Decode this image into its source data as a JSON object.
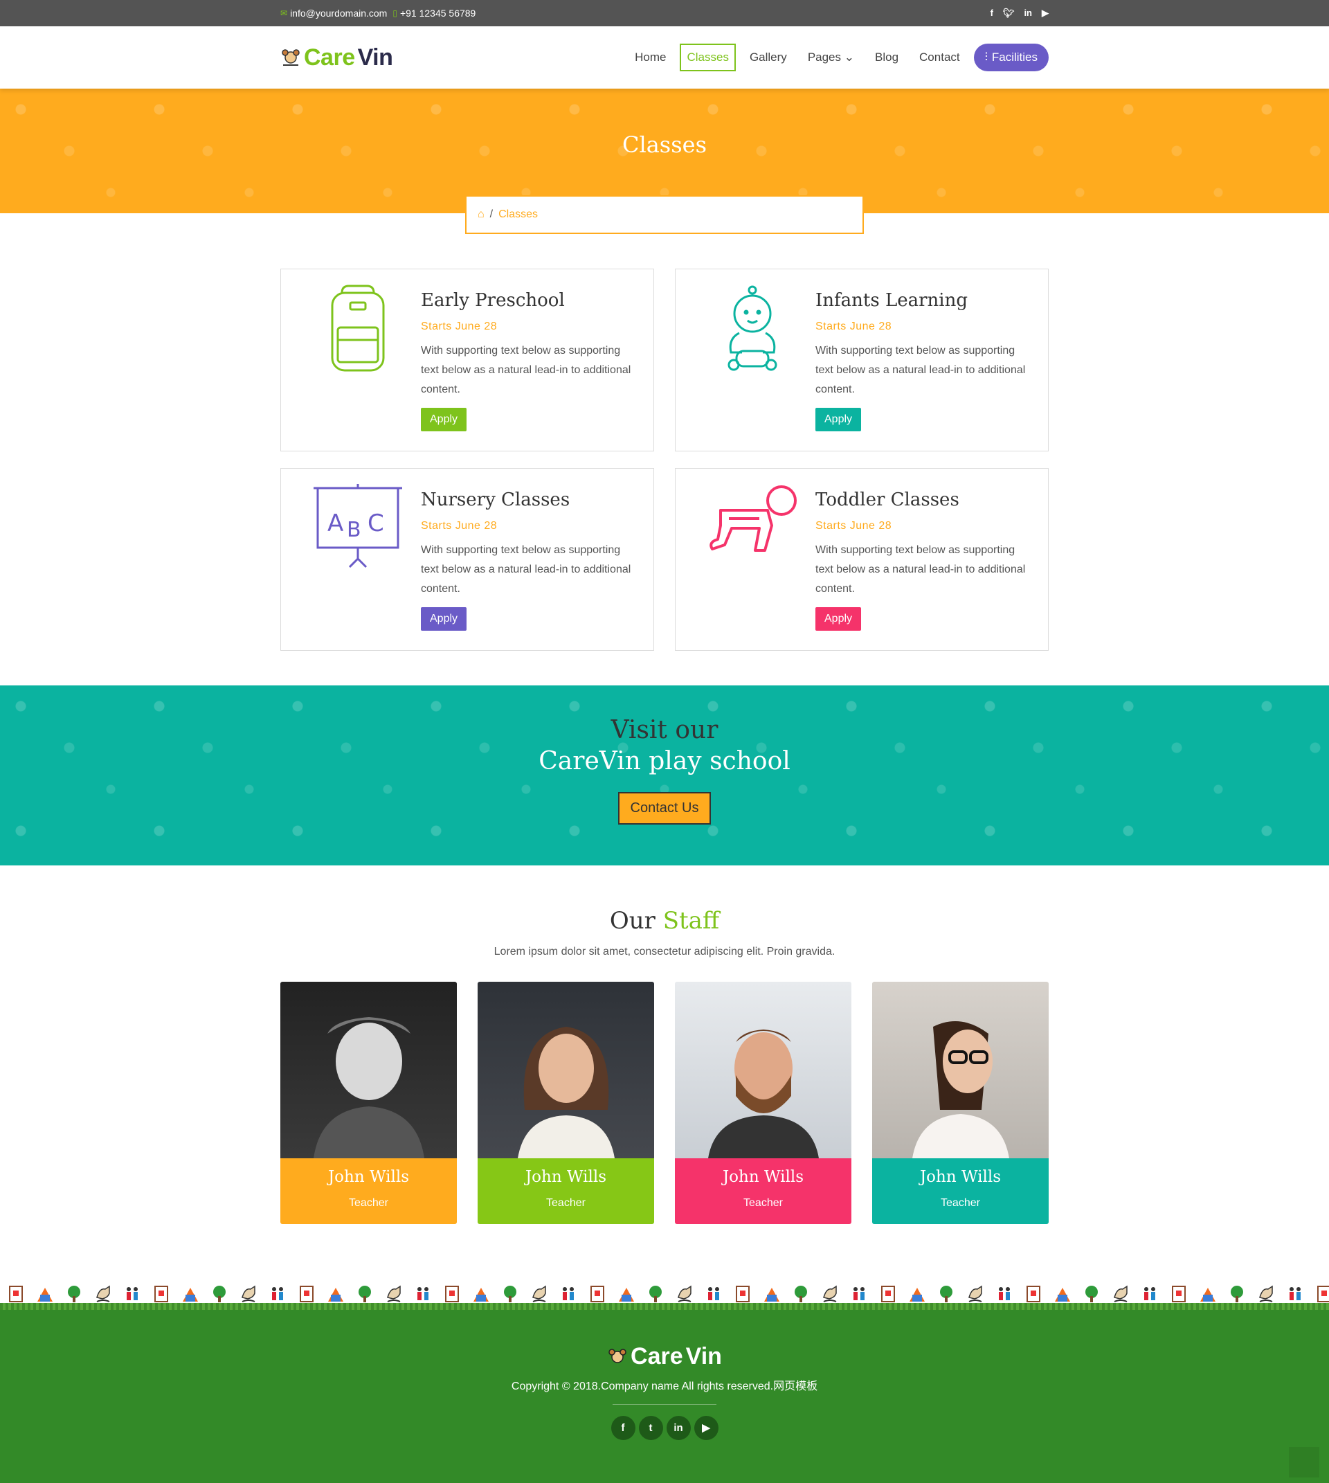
{
  "topbar": {
    "email": "info@yourdomain.com",
    "phone": "+91 12345 56789",
    "social": {
      "facebook": "f",
      "twitter": "t",
      "linkedin": "in",
      "youtube": "▶"
    }
  },
  "header": {
    "logo_care": "Care",
    "logo_vin": "Vin",
    "nav": [
      "Home",
      "Classes",
      "Gallery",
      "Pages",
      "Blog",
      "Contact"
    ],
    "facilities": "Facilities"
  },
  "hero": {
    "title": "Classes",
    "breadcrumb_current": "Classes",
    "breadcrumb_sep": "/"
  },
  "classes": [
    {
      "title": "Early Preschool",
      "date": "Starts June 28",
      "text": "With supporting text below as supporting text below as a natural lead-in to additional content.",
      "button": "Apply",
      "color": "#7ec31c",
      "icon": "backpack-icon"
    },
    {
      "title": "Infants Learning",
      "date": "Starts June 28",
      "text": "With supporting text below as supporting text below as a natural lead-in to additional content.",
      "button": "Apply",
      "color": "#0bb3a0",
      "icon": "baby-icon"
    },
    {
      "title": "Nursery Classes",
      "date": "Starts June 28",
      "text": "With supporting text below as supporting text below as a natural lead-in to additional content.",
      "button": "Apply",
      "color": "#6a5bc7",
      "icon": "abc-board-icon"
    },
    {
      "title": "Toddler Classes",
      "date": "Starts June 28",
      "text": "With supporting text below as supporting text below as a natural lead-in to additional content.",
      "button": "Apply",
      "color": "#f5336a",
      "icon": "crawling-baby-icon"
    }
  ],
  "visit": {
    "line1": "Visit our",
    "line2": "CareVin play school",
    "button": "Contact Us"
  },
  "staff": {
    "title_a": "Our",
    "title_b": "Staff",
    "subtitle": "Lorem ipsum dolor sit amet, consectetur adipiscing elit. Proin gravida.",
    "members": [
      {
        "name": "John Wills",
        "role": "Teacher",
        "color": "#ffab1e"
      },
      {
        "name": "John Wills",
        "role": "Teacher",
        "color": "#86c716"
      },
      {
        "name": "John Wills",
        "role": "Teacher",
        "color": "#f5336a"
      },
      {
        "name": "John Wills",
        "role": "Teacher",
        "color": "#0bb3a0"
      }
    ]
  },
  "footer": {
    "logo_care": "Care",
    "logo_vin": "Vin",
    "copyright": "Copyright © 2018.Company name All rights reserved.网页模板"
  }
}
